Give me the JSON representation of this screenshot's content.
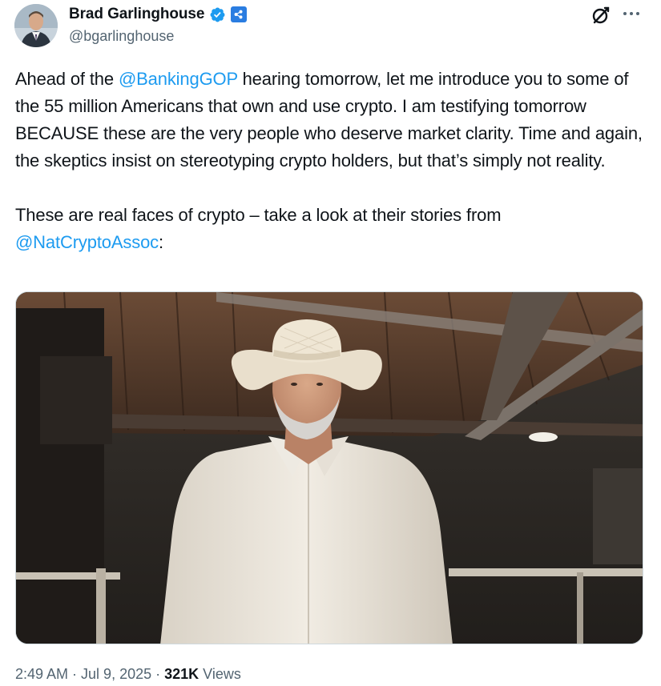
{
  "author": {
    "display_name": "Brad Garlinghouse",
    "handle": "@bgarlinghouse",
    "verified": true
  },
  "tweet": {
    "segments_p1": [
      {
        "type": "text",
        "text": "Ahead of the "
      },
      {
        "type": "mention",
        "text": "@BankingGOP"
      },
      {
        "type": "text",
        "text": " hearing tomorrow, let me introduce you to some of the 55 million Americans that own and use crypto. I am testifying tomorrow BECAUSE these are the very people who deserve market clarity. Time and again, the skeptics insist on stereotyping crypto holders, but that’s simply not reality."
      }
    ],
    "segments_p2": [
      {
        "type": "text",
        "text": "These are real faces of crypto – take a look at their stories from "
      },
      {
        "type": "mention",
        "text": "@NatCryptoAssoc"
      },
      {
        "type": "text",
        "text": ":"
      }
    ]
  },
  "meta": {
    "time": "2:49 AM",
    "separator": " · ",
    "date": "Jul 9, 2025",
    "views_count": "321K",
    "views_label": " Views"
  },
  "colors": {
    "link": "#1d9bf0",
    "secondary_text": "#536471",
    "verified": "#1d9bf0",
    "affiliate": "#2a7de1"
  },
  "icons": {
    "verified": "verified-check-icon",
    "affiliate": "ripple-affiliate-icon",
    "grok": "grok-icon",
    "more": "more-horizontal-icon"
  }
}
